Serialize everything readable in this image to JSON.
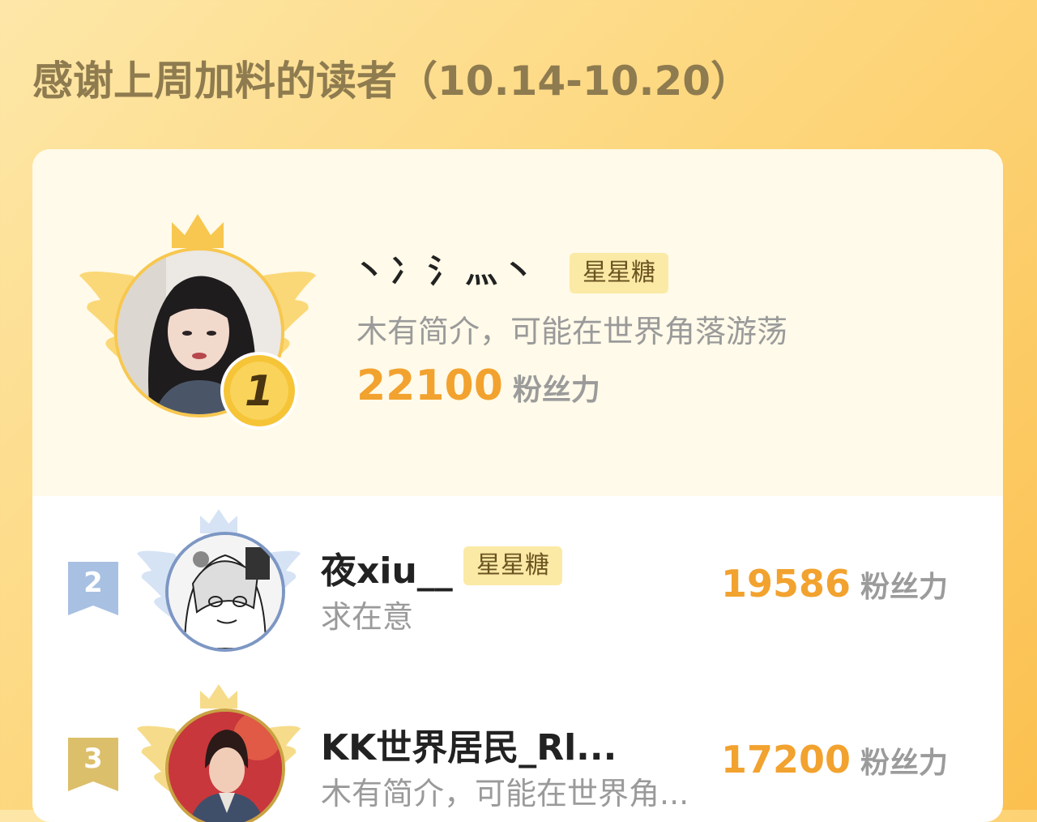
{
  "header": {
    "title": "感谢上周加料的读者（10.14-10.20）"
  },
  "fans_label": "粉丝力",
  "leaderboard": [
    {
      "rank": "1",
      "name": "丶冫氵灬丶",
      "tag": "星星糖",
      "bio": "木有简介，可能在世界角落游荡",
      "fans": "22100"
    },
    {
      "rank": "2",
      "name": "夜xiu__",
      "tag": "星星糖",
      "bio": "求在意",
      "fans": "19586"
    },
    {
      "rank": "3",
      "name": "KK世界居民_Rl...",
      "bio": "木有简介，可能在世界角...",
      "fans": "17200"
    }
  ],
  "colors": {
    "gold": "#f7c74f",
    "silver": "#9fb7dc",
    "bronze": "#dcbf6a",
    "fans_number": "#f2a22e"
  }
}
